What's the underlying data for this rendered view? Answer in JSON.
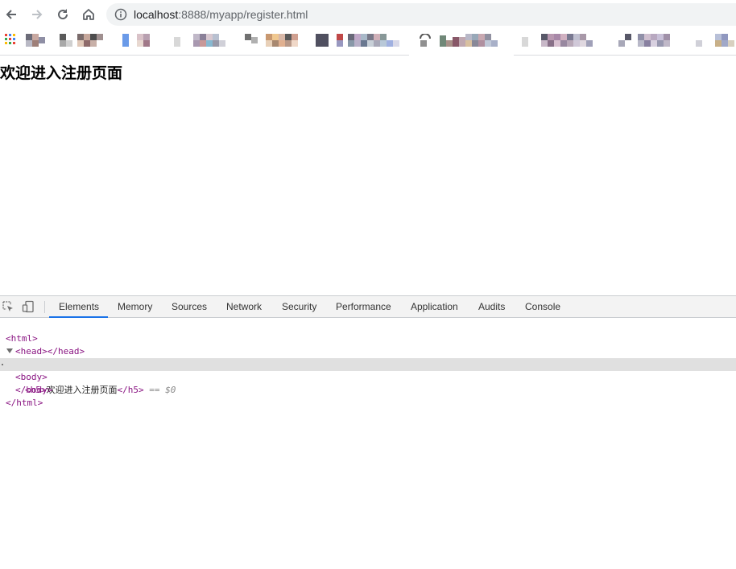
{
  "browser": {
    "url_host": "localhost",
    "url_rest": ":8888/myapp/register.html",
    "icons": [
      "back-arrow-icon",
      "forward-arrow-icon",
      "reload-icon",
      "home-icon",
      "info-icon",
      "apps-grid-icon"
    ]
  },
  "page": {
    "heading": "欢迎进入注册页面"
  },
  "devtools": {
    "tabs": [
      "Elements",
      "Memory",
      "Sources",
      "Network",
      "Security",
      "Performance",
      "Application",
      "Audits",
      "Console"
    ],
    "active_tab": "Elements",
    "dom": {
      "html_open": "<html>",
      "head": "<head></head>",
      "body_open": "<body>",
      "h5_open": "<h5>",
      "h5_text": "欢迎进入注册页面",
      "h5_close": "</h5>",
      "eq": "==",
      "dollar": "$0",
      "body_close": "</body>",
      "html_close": "</html>"
    }
  },
  "colors": {
    "accent": "#1a73e8",
    "tag": "#881280",
    "selection": "#e0e0e0"
  }
}
